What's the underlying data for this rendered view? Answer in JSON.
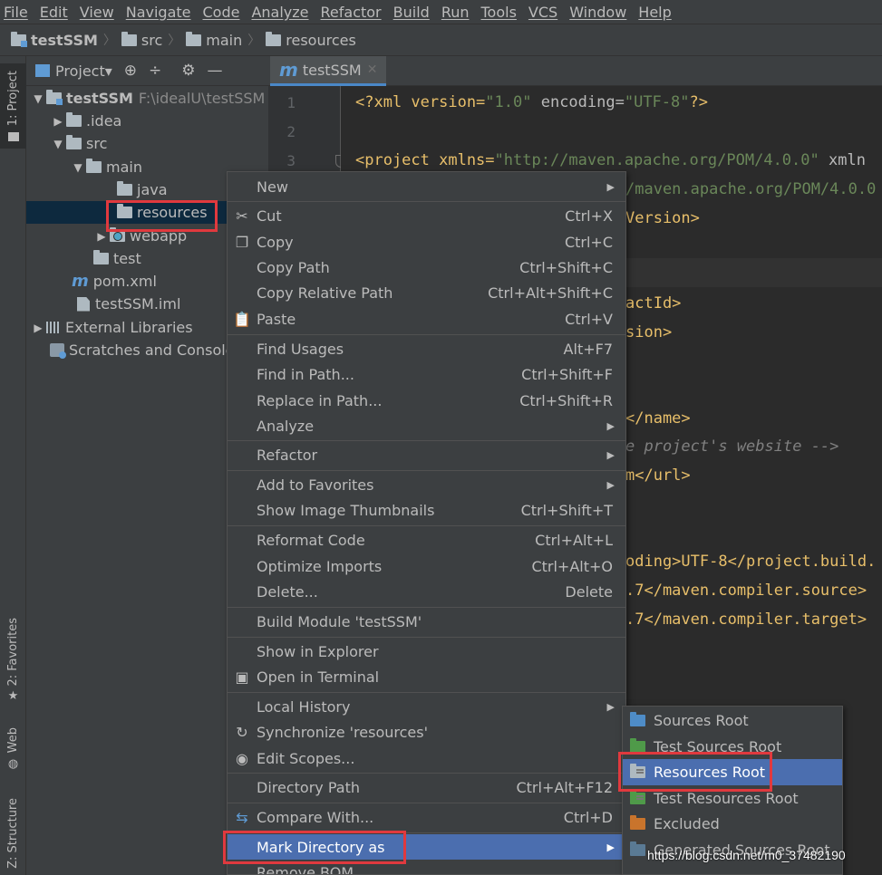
{
  "menubar": [
    "File",
    "Edit",
    "View",
    "Navigate",
    "Code",
    "Analyze",
    "Refactor",
    "Build",
    "Run",
    "Tools",
    "VCS",
    "Window",
    "Help"
  ],
  "breadcrumb": [
    "testSSM",
    "src",
    "main",
    "resources"
  ],
  "left_strip": {
    "project": "1: Project",
    "favorites": "2: Favorites",
    "web": "Web",
    "structure": "Z: Structure"
  },
  "project_panel": {
    "title": "Project▾"
  },
  "tree": {
    "root": "testSSM",
    "root_path": "F:\\idealU\\testSSM",
    "idea": ".idea",
    "src": "src",
    "main": "main",
    "java": "java",
    "resources": "resources",
    "webapp": "webapp",
    "test": "test",
    "pom": "pom.xml",
    "iml": "testSSM.iml",
    "external": "External Libraries",
    "scratches": "Scratches and Consoles"
  },
  "editor": {
    "tab": "testSSM",
    "line_numbers": [
      "1",
      "2",
      "3"
    ],
    "code": {
      "l1_a": "<?xml version=",
      "l1_b": "\"1.0\"",
      "l1_c": " encoding=",
      "l1_d": "\"UTF-8\"",
      "l1_e": "?>",
      "l3_a": "<project xmlns=",
      "l3_b": "\"http://maven.apache.org/POM/4.0.0\"",
      "l3_c": " xmln",
      "l4": "/maven.apache.org/POM/4.0.0",
      "l5": "Version>",
      "l8": "actId>",
      "l9": "sion>",
      "l12": "</name>",
      "l13": "e project's website -->",
      "l14": "m</url>",
      "l17": "oding>UTF-8</project.build.",
      "l18": ".7</maven.compiler.source>",
      "l19": ".7</maven.compiler.target>"
    }
  },
  "context_menu": {
    "new": "New",
    "cut": "Cut",
    "cut_sc": "Ctrl+X",
    "copy": "Copy",
    "copy_sc": "Ctrl+C",
    "copy_path": "Copy Path",
    "copy_path_sc": "Ctrl+Shift+C",
    "copy_rel": "Copy Relative Path",
    "copy_rel_sc": "Ctrl+Alt+Shift+C",
    "paste": "Paste",
    "paste_sc": "Ctrl+V",
    "find_usages": "Find Usages",
    "find_usages_sc": "Alt+F7",
    "find_in_path": "Find in Path...",
    "find_in_path_sc": "Ctrl+Shift+F",
    "replace_in_path": "Replace in Path...",
    "replace_in_path_sc": "Ctrl+Shift+R",
    "analyze": "Analyze",
    "refactor": "Refactor",
    "add_fav": "Add to Favorites",
    "thumbs": "Show Image Thumbnails",
    "thumbs_sc": "Ctrl+Shift+T",
    "reformat": "Reformat Code",
    "reformat_sc": "Ctrl+Alt+L",
    "optimize": "Optimize Imports",
    "optimize_sc": "Ctrl+Alt+O",
    "delete": "Delete...",
    "delete_sc": "Delete",
    "build_module": "Build Module 'testSSM'",
    "show_explorer": "Show in Explorer",
    "open_terminal": "Open in Terminal",
    "local_history": "Local History",
    "synchronize": "Synchronize 'resources'",
    "edit_scopes": "Edit Scopes...",
    "dir_path": "Directory Path",
    "dir_path_sc": "Ctrl+Alt+F12",
    "compare": "Compare With...",
    "compare_sc": "Ctrl+D",
    "mark_dir": "Mark Directory as",
    "remove_bom": "Remove BOM"
  },
  "submenu": {
    "sources_root": "Sources Root",
    "test_sources_root": "Test Sources Root",
    "resources_root": "Resources Root",
    "test_resources_root": "Test Resources Root",
    "excluded": "Excluded",
    "generated_sources_root": "Generated Sources Root"
  },
  "watermark": "https://blog.csdn.net/m0_37482190",
  "colors": {
    "highlight": "#4b6eaf",
    "annotation": "#e0393e",
    "selection": "#0d293e"
  }
}
